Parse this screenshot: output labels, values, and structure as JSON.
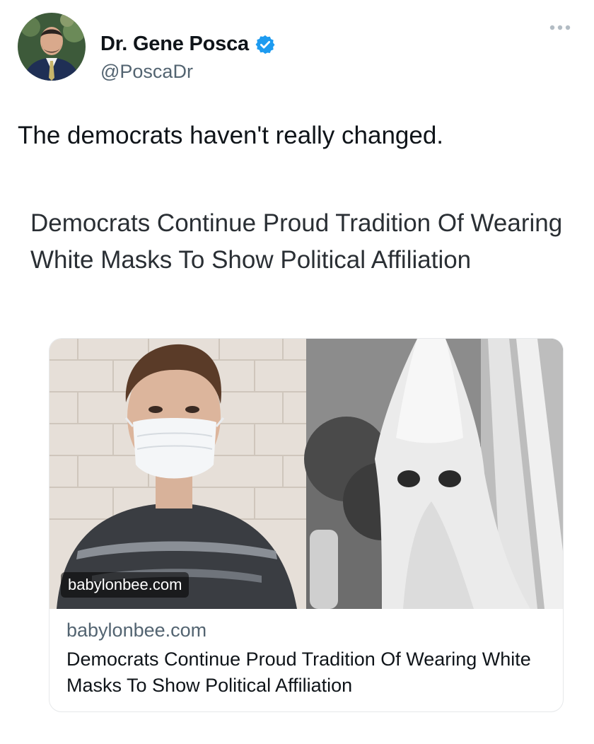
{
  "author": {
    "display_name": "Dr. Gene Posca",
    "handle": "@PoscaDr",
    "verified": true,
    "avatar_icon": "profile-photo"
  },
  "tweet": {
    "text": "The democrats haven't really changed."
  },
  "quote": {
    "headline": "Democrats Continue Proud Tradition Of Wearing White Masks To Show Political Affiliation"
  },
  "link_card": {
    "image_watermark": "babylonbee.com",
    "domain": "babylonbee.com",
    "title": "Democrats Continue Proud Tradition Of Wearing White Masks To Show Political Affiliation"
  },
  "colors": {
    "verified_blue": "#1d9bf0",
    "secondary_text": "#536471",
    "primary_text": "#0f1419"
  }
}
